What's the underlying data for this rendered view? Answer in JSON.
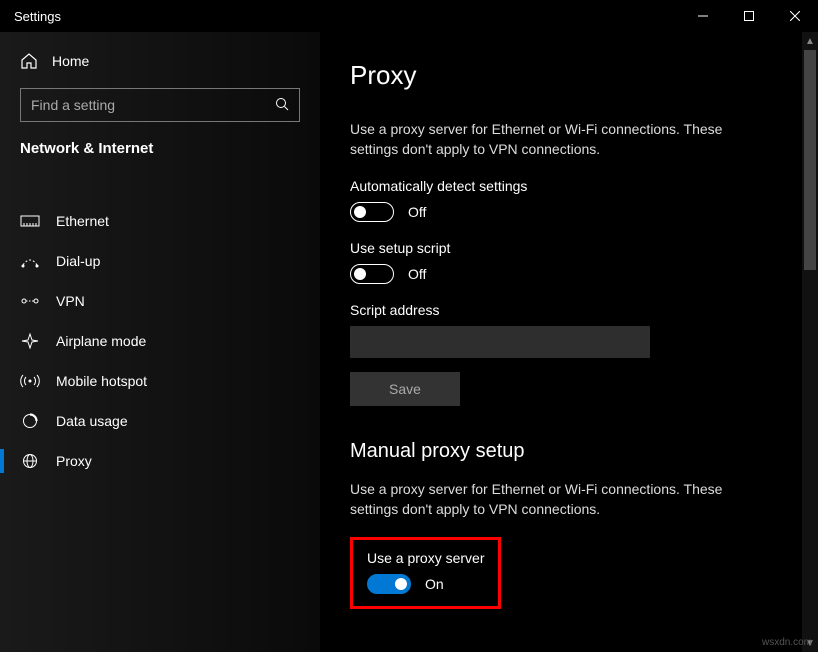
{
  "window": {
    "title": "Settings"
  },
  "sidebar": {
    "home_label": "Home",
    "search_placeholder": "Find a setting",
    "section_title": "Network & Internet",
    "items": [
      {
        "label": "Ethernet"
      },
      {
        "label": "Dial-up"
      },
      {
        "label": "VPN"
      },
      {
        "label": "Airplane mode"
      },
      {
        "label": "Mobile hotspot"
      },
      {
        "label": "Data usage"
      },
      {
        "label": "Proxy"
      }
    ],
    "selected_index": 6
  },
  "main": {
    "page_title": "Proxy",
    "auto_desc": "Use a proxy server for Ethernet or Wi-Fi connections. These settings don't apply to VPN connections.",
    "auto_detect_label": "Automatically detect settings",
    "auto_detect_state": "Off",
    "setup_script_label": "Use setup script",
    "setup_script_state": "Off",
    "script_address_label": "Script address",
    "script_address_value": "",
    "save_label": "Save",
    "manual_heading": "Manual proxy setup",
    "manual_desc": "Use a proxy server for Ethernet or Wi-Fi connections. These settings don't apply to VPN connections.",
    "use_proxy_label": "Use a proxy server",
    "use_proxy_state": "On"
  },
  "watermark": "wsxdn.com"
}
